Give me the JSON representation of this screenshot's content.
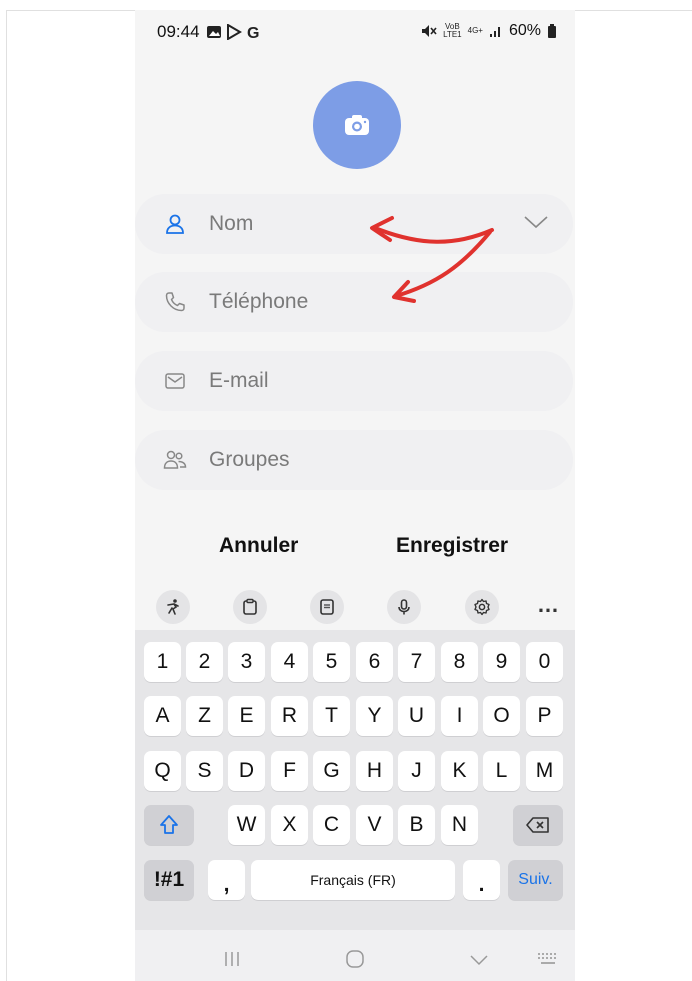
{
  "status_bar": {
    "time": "09:44",
    "network_label_top": "VoB",
    "network_label_bottom": "LTE1",
    "network_type": "4G+",
    "battery": "60%"
  },
  "avatar": {
    "icon": "camera-icon",
    "color": "#7d9de6"
  },
  "form": {
    "fields": [
      {
        "label": "Nom",
        "icon": "person-icon"
      },
      {
        "label": "Téléphone",
        "icon": "phone-icon"
      },
      {
        "label": "E-mail",
        "icon": "mail-icon"
      },
      {
        "label": "Groupes",
        "icon": "group-icon"
      }
    ]
  },
  "actions": {
    "cancel": "Annuler",
    "save": "Enregistrer"
  },
  "keyboard": {
    "toolbar": [
      "emoji-icon",
      "clipboard-icon",
      "keypad-icon",
      "mic-icon",
      "settings-icon",
      "more-icon"
    ],
    "more_label": "…",
    "row_numbers": [
      "1",
      "2",
      "3",
      "4",
      "5",
      "6",
      "7",
      "8",
      "9",
      "0"
    ],
    "row_1": [
      "A",
      "Z",
      "E",
      "R",
      "T",
      "Y",
      "U",
      "I",
      "O",
      "P"
    ],
    "row_2": [
      "Q",
      "S",
      "D",
      "F",
      "G",
      "H",
      "J",
      "K",
      "L",
      "M"
    ],
    "row_3": [
      "W",
      "X",
      "C",
      "V",
      "B",
      "N"
    ],
    "symbols": "!#1",
    "comma": ",",
    "space": "Français (FR)",
    "period": ".",
    "next": "Suiv."
  },
  "colors": {
    "accent": "#1a73e8",
    "avatar": "#7d9de6",
    "annotation": "#e0322e"
  }
}
